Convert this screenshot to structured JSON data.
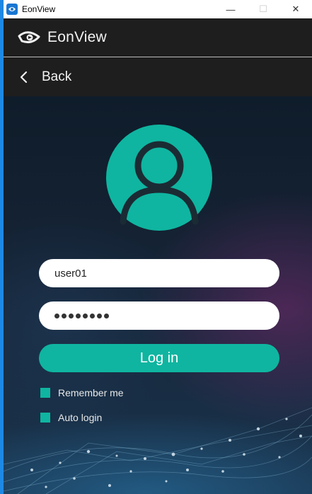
{
  "window": {
    "title": "EonView",
    "controls": {
      "minimize": "—",
      "maximize": "☐",
      "close": "✕"
    }
  },
  "header": {
    "brand": "EonView",
    "logo_icon": "eye-logo-icon"
  },
  "back": {
    "label": "Back",
    "icon": "chevron-left-icon"
  },
  "login": {
    "avatar_icon": "user-avatar-icon",
    "username_value": "user01",
    "password_mask_length": 8,
    "login_label": "Log in",
    "remember_label": "Remember me",
    "autologin_label": "Auto login"
  },
  "colors": {
    "accent": "#0fb5a0",
    "header_bg": "#1e1e1e",
    "window_border": "#1e88e5"
  }
}
